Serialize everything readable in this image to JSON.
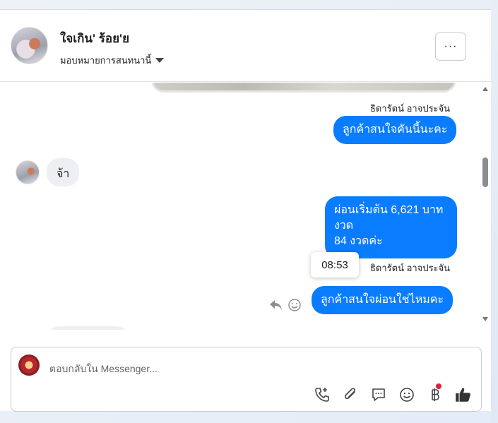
{
  "header": {
    "contact_name": "ใจเกิน' ร้อย'ย",
    "assign_label": "มอบหมายการสนทนานี้",
    "more_label": "···"
  },
  "messages": [
    {
      "type": "sender_label",
      "text": "ธิดารัตน์ อาจประจัน"
    },
    {
      "type": "outgoing",
      "text": "ลูกค้าสนใจคันนี้นะคะ"
    },
    {
      "type": "incoming",
      "text": "จ้า"
    },
    {
      "type": "outgoing",
      "lines": [
        "ผ่อนเริ่มต้น 6,621 บาท",
        "งวด",
        "84 งวดค่ะ"
      ]
    },
    {
      "type": "sender_label",
      "text": "ธิดารัตน์ อาจประจัน"
    },
    {
      "type": "outgoing",
      "text": "ลูกค้าสนใจผ่อนใช่ไหมคะ"
    }
  ],
  "tooltip": {
    "time": "08:53"
  },
  "composer": {
    "placeholder": "ตอบกลับใน Messenger..."
  },
  "toolbar_icons": [
    "phone-plus-icon",
    "paperclip-icon",
    "chat-bubble-icon",
    "emoji-icon",
    "baht-icon",
    "thumbs-up-icon"
  ],
  "colors": {
    "outgoing_bubble": "#0a7cff",
    "incoming_bubble": "#eeeff2",
    "notification_dot": "#e41e3f"
  }
}
